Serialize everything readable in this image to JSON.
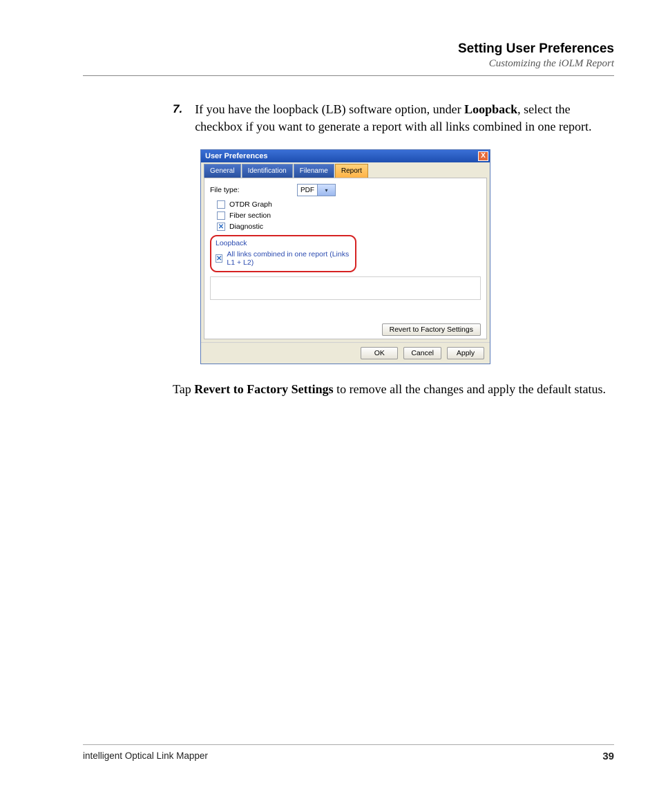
{
  "header": {
    "title": "Setting User Preferences",
    "subtitle": "Customizing the iOLM Report"
  },
  "step": {
    "number": "7.",
    "text_before": "If you have the loopback (LB) software option, under ",
    "bold1": "Loopback",
    "text_after": ", select the checkbox if you want to generate a report with all links combined in one report."
  },
  "dialog": {
    "title": "User Preferences",
    "close": "X",
    "tabs": {
      "general": "General",
      "identification": "Identification",
      "filename": "Filename",
      "report": "Report"
    },
    "file_type_label": "File type:",
    "file_type_value": "PDF",
    "checkboxes": {
      "otdr_graph": {
        "label": "OTDR Graph",
        "checked": false
      },
      "fiber_section": {
        "label": "Fiber section",
        "checked": false
      },
      "diagnostic": {
        "label": "Diagnostic",
        "checked": true
      }
    },
    "loopback": {
      "group_title": "Loopback",
      "option_label": "All links combined in one report (Links L1 + L2)",
      "checked": true
    },
    "revert_button": "Revert to Factory Settings",
    "buttons": {
      "ok": "OK",
      "cancel": "Cancel",
      "apply": "Apply"
    }
  },
  "paragraph": {
    "before": "Tap ",
    "bold": "Revert to Factory Settings",
    "after": " to remove all the changes and apply the default status."
  },
  "footer": {
    "product": "intelligent Optical Link Mapper",
    "page": "39"
  }
}
